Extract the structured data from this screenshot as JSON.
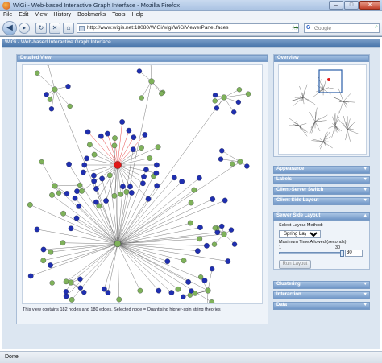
{
  "window": {
    "title": "WiGi - Web-based Interactive Graph Interface - Mozilla Firefox",
    "minimize": "–",
    "maximize": "□",
    "close": "✕"
  },
  "menu": [
    "File",
    "Edit",
    "View",
    "History",
    "Bookmarks",
    "Tools",
    "Help"
  ],
  "nav": {
    "back": "◀",
    "forward": "▸",
    "reload": "↻",
    "stop": "✕",
    "home": "⌂",
    "url": "http://www.wigis.net:18080/WiGi/wigi/WiGiViewerPanel.faces",
    "go": "➜",
    "search_placeholder": "Google",
    "search_engine": "G"
  },
  "app": {
    "header": "WiGi - Web-based Interactive Graph Interface"
  },
  "detail": {
    "title": "Detailed View",
    "info": "This view contains 182 nodes and 180 edges. Selected node = Quantising higher-spin string theories"
  },
  "overview": {
    "title": "Overview"
  },
  "panels": {
    "appearance": "Appearance",
    "labels": "Labels",
    "client_server_switch": "Client-Server Switch",
    "client_side_layout": "Client Side Layout",
    "server_side_layout": "Server Side Layout",
    "clustering": "Clustering",
    "interaction": "Interaction",
    "data": "Data"
  },
  "server_layout": {
    "method_label": "Select Layout Method:",
    "method_value": "Spring Layout",
    "time_label": "Maximum Time Allowed (seconds):",
    "slider_min": "1",
    "slider_max": "30",
    "time_value": "30",
    "slider_fraction": 1.0,
    "run_button": "Run Layout"
  },
  "status": "Done",
  "colors": {
    "node_blue": "#1f2fb0",
    "node_green": "#7fb25a",
    "node_red": "#e01818",
    "edge": "#5a5a5a",
    "header_blue": "#4a77ab"
  }
}
